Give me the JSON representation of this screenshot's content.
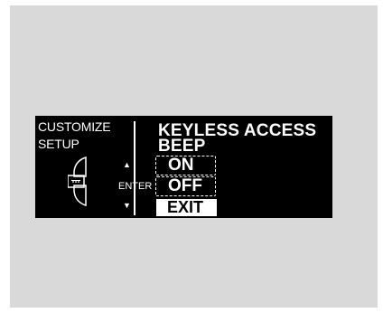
{
  "display": {
    "left_line1": "CUSTOMIZE",
    "left_line2": "SETUP",
    "up_arrow": "▲",
    "down_arrow": "▼",
    "enter_label": "ENTER",
    "title_line1": "KEYLESS ACCESS",
    "title_line2": "BEEP",
    "options": [
      {
        "label": "ON"
      },
      {
        "label": "OFF"
      }
    ],
    "exit_label": "EXIT"
  },
  "icons": [
    "selector-dial-icon",
    "up-arrow-icon",
    "down-arrow-icon"
  ]
}
